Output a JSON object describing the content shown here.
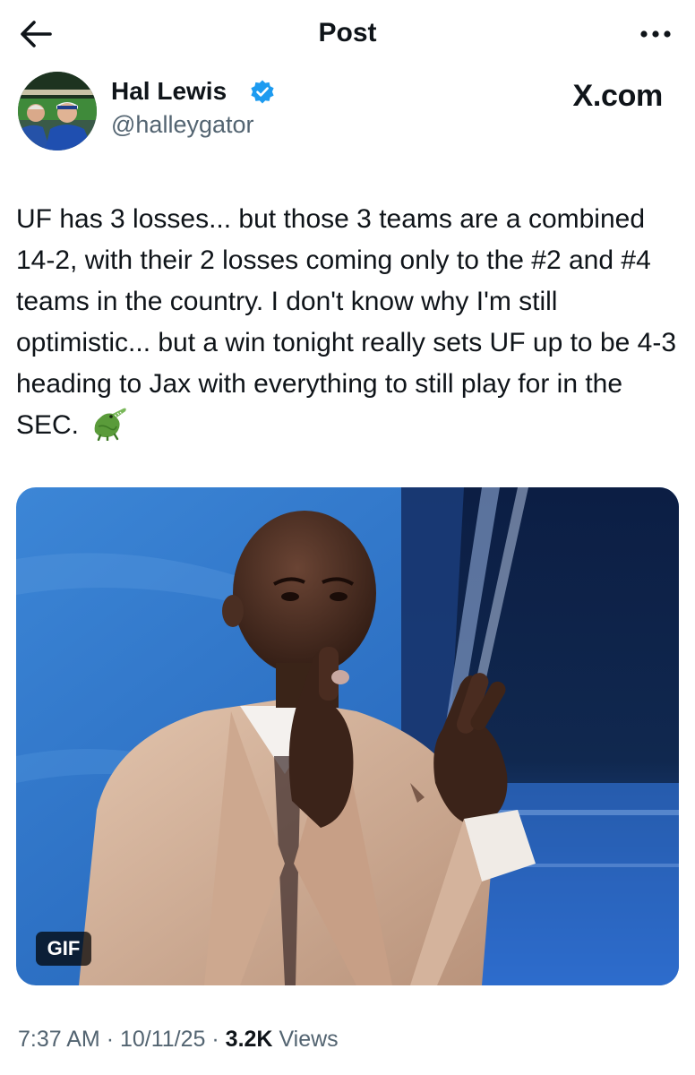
{
  "header": {
    "title": "Post",
    "back_icon": "arrow-left-icon",
    "more_icon": "more-horizontal-icon"
  },
  "author": {
    "display_name": "Hal Lewis",
    "handle": "@halleygator",
    "verified": true,
    "verified_color": "#1d9bf0"
  },
  "site_label": "X.com",
  "post": {
    "text": "UF has 3 losses... but those 3 teams are a combined 14-2, with their 2 losses coming only to the #2 and #4 teams in the country. I don't know why I'm still optimistic... but a win tonight really sets UF up to be 4-3 heading to Jax with everything to still play for in the SEC.",
    "emoji": "crocodile-emoji"
  },
  "media": {
    "type": "gif",
    "badge": "GIF"
  },
  "meta": {
    "time": "7:37 AM",
    "sep1": "·",
    "date": "10/11/25",
    "sep2": "·",
    "views_count": "3.2K",
    "views_label": "Views"
  }
}
